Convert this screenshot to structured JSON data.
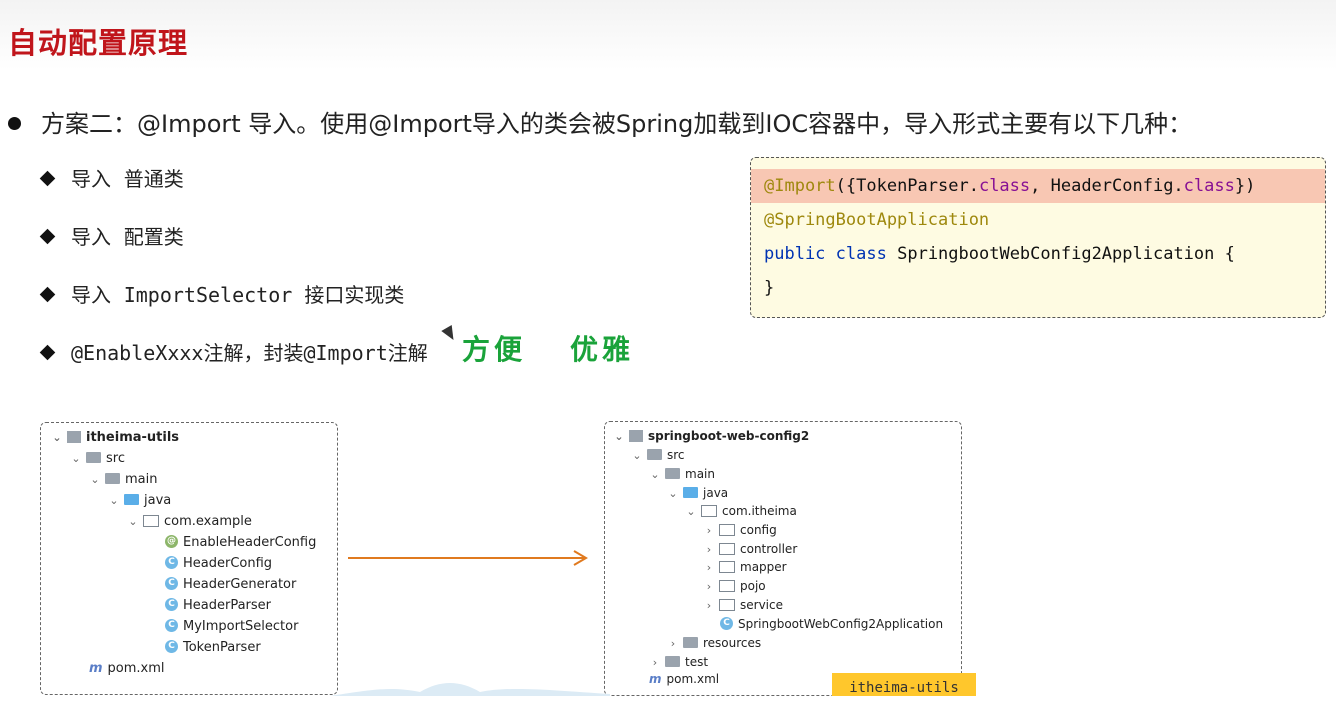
{
  "slide": {
    "title": "自动配置原理",
    "main_bullet": "方案二：@Import 导入。使用@Import导入的类会被Spring加载到IOC容器中，导入形式主要有以下几种：",
    "sub_items": [
      {
        "prefix": "导入",
        "text": "普通类"
      },
      {
        "prefix": "导入",
        "text": "配置类"
      },
      {
        "prefix": "导入",
        "text": "ImportSelector 接口实现类"
      },
      {
        "prefix": "",
        "text": "@EnableXxxx注解，封装@Import注解"
      }
    ],
    "handwriting": [
      "方便",
      "优雅"
    ],
    "code": {
      "line1": {
        "anno": "@Import",
        "a": "({TokenParser.",
        "k1": "class",
        "b": ", HeaderConfig.",
        "k2": "class",
        "c": "})"
      },
      "line2": "@SpringBootApplication",
      "line3": {
        "kw1": "public",
        "kw2": "class",
        "rest": "SpringbootWebConfig2Application {"
      },
      "line4": "}"
    },
    "left_tree": {
      "project": "itheima-utils",
      "src": "src",
      "main": "main",
      "java": "java",
      "package": "com.example",
      "classes": [
        "EnableHeaderConfig",
        "HeaderConfig",
        "HeaderGenerator",
        "HeaderParser",
        "MyImportSelector",
        "TokenParser"
      ],
      "pom": "pom.xml"
    },
    "right_tree": {
      "project": "springboot-web-config2",
      "src": "src",
      "main": "main",
      "java": "java",
      "package": "com.itheima",
      "folders": [
        "config",
        "controller",
        "mapper",
        "pojo",
        "service"
      ],
      "app_class": "SpringbootWebConfig2Application",
      "resources": "resources",
      "test": "test",
      "pom": "pom.xml"
    },
    "footer_tag": "itheima-utils",
    "colors": {
      "title": "#c0151b",
      "highlight": "#f8c7b3",
      "code_bg": "#fefbe2",
      "arrow": "#e07a1f",
      "tag": "#ffc72c",
      "handwriting": "#1aa33a"
    }
  }
}
